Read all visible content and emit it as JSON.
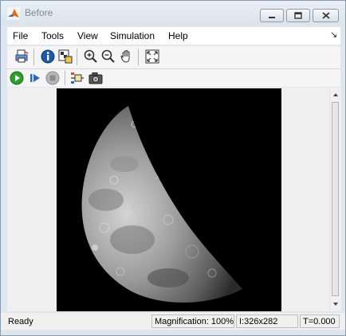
{
  "window": {
    "title": "Before"
  },
  "menubar": {
    "items": [
      "File",
      "Tools",
      "View",
      "Simulation",
      "Help"
    ]
  },
  "toolbar": {
    "icons": [
      "print-icon",
      "info-icon",
      "pixel-region-icon",
      "zoom-in-icon",
      "zoom-out-icon",
      "pan-hand-icon",
      "fit-to-window-icon"
    ]
  },
  "simbar": {
    "icons": [
      "run-icon",
      "step-forward-icon",
      "stop-icon",
      "signal-selector-icon",
      "snapshot-camera-icon"
    ]
  },
  "status": {
    "ready": "Ready",
    "magnification": "Magnification: 100%",
    "dimensions": "I:326x282",
    "time": "T=0.000"
  },
  "colors": {
    "stop_fill": "#b8b8b8",
    "run_fill": "#2e9e2e",
    "info_fill": "#1e5aa8"
  }
}
